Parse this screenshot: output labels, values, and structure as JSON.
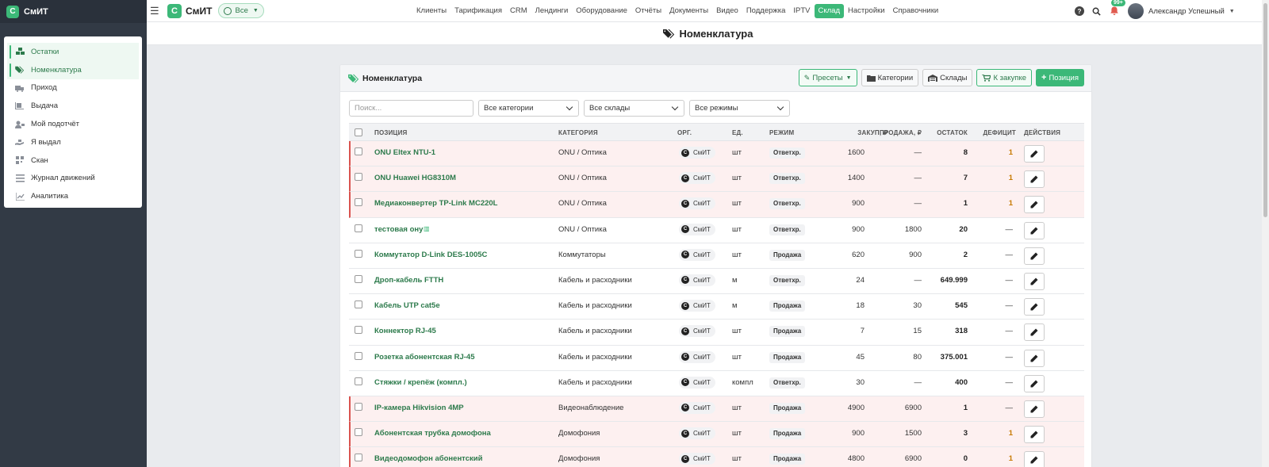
{
  "sidebar": {
    "logo_letter": "С",
    "logo_text": "СмИТ",
    "items": [
      {
        "label": "Остатки",
        "icon": "boxes-icon",
        "active": true
      },
      {
        "label": "Номенклатура",
        "icon": "tags-icon",
        "active": true
      },
      {
        "label": "Приход",
        "icon": "truck-loading-icon",
        "active": false
      },
      {
        "label": "Выдача",
        "icon": "dolly-icon",
        "active": false
      },
      {
        "label": "Мой подотчёт",
        "icon": "user-tag-icon",
        "active": false
      },
      {
        "label": "Я выдал",
        "icon": "hand-holding-icon",
        "active": false
      },
      {
        "label": "Скан",
        "icon": "qrcode-icon",
        "active": false
      },
      {
        "label": "Журнал движений",
        "icon": "list-icon",
        "active": false
      },
      {
        "label": "Аналитика",
        "icon": "chart-line-icon",
        "active": false
      }
    ]
  },
  "topbar": {
    "logo_letter": "С",
    "logo_text": "СмИТ",
    "scope_label": "Все",
    "nav": [
      "Клиенты",
      "Тарификация",
      "CRM",
      "Лендинги",
      "Оборудование",
      "Отчёты",
      "Документы",
      "Видео",
      "Поддержка",
      "IPTV",
      "Склад",
      "Настройки",
      "Справочники"
    ],
    "active_nav": "Склад",
    "help": "?",
    "notif_badge": "99+",
    "user_name": "Александр Успешный"
  },
  "page_header": {
    "title": "Номенклатура"
  },
  "card": {
    "title": "Номенклатура",
    "buttons": {
      "presets": "Пресеты",
      "categories": "Категории",
      "warehouses": "Склады",
      "to_purchase": "К закупке",
      "add_position": "Позиция"
    },
    "filters": {
      "search_placeholder": "Поиск...",
      "category": "Все категории",
      "warehouse": "Все склады",
      "mode": "Все режимы"
    },
    "columns": [
      "Позиция",
      "Категория",
      "Орг.",
      "Ед.",
      "Режим",
      "Закуп, ₽",
      "Продажа, ₽",
      "Остаток",
      "Дефицит",
      "Действия"
    ],
    "rows": [
      {
        "name": "ONU Eltex NTU-1",
        "category": "ONU / Оптика",
        "org": "СмИТ",
        "unit": "шт",
        "mode": "Ответхр.",
        "buy": "1600",
        "sell": "—",
        "stock": "8",
        "deficit": "1",
        "highlight": true
      },
      {
        "name": "ONU Huawei HG8310M",
        "category": "ONU / Оптика",
        "org": "СмИТ",
        "unit": "шт",
        "mode": "Ответхр.",
        "buy": "1400",
        "sell": "—",
        "stock": "7",
        "deficit": "1",
        "highlight": true
      },
      {
        "name": "Медиаконвертер TP-Link MC220L",
        "category": "ONU / Оптика",
        "org": "СмИТ",
        "unit": "шт",
        "mode": "Ответхр.",
        "buy": "900",
        "sell": "—",
        "stock": "1",
        "deficit": "1",
        "highlight": true
      },
      {
        "name": "тестовая ону",
        "category": "ONU / Оптика",
        "org": "СмИТ",
        "unit": "шт",
        "mode": "Ответхр.",
        "buy": "900",
        "sell": "1800",
        "stock": "20",
        "deficit": "—",
        "highlight": false
      },
      {
        "name": "Коммутатор D-Link DES-1005C",
        "category": "Коммутаторы",
        "org": "СмИТ",
        "unit": "шт",
        "mode": "Продажа",
        "buy": "620",
        "sell": "900",
        "stock": "2",
        "deficit": "—",
        "highlight": false
      },
      {
        "name": "Дроп-кабель FTTH",
        "category": "Кабель и расходники",
        "org": "СмИТ",
        "unit": "м",
        "mode": "Ответхр.",
        "buy": "24",
        "sell": "—",
        "stock": "649.999",
        "deficit": "—",
        "highlight": false
      },
      {
        "name": "Кабель UTP cat5e",
        "category": "Кабель и расходники",
        "org": "СмИТ",
        "unit": "м",
        "mode": "Продажа",
        "buy": "18",
        "sell": "30",
        "stock": "545",
        "deficit": "—",
        "highlight": false
      },
      {
        "name": "Коннектор RJ-45",
        "category": "Кабель и расходники",
        "org": "СмИТ",
        "unit": "шт",
        "mode": "Продажа",
        "buy": "7",
        "sell": "15",
        "stock": "318",
        "deficit": "—",
        "highlight": false
      },
      {
        "name": "Розетка абонентская RJ-45",
        "category": "Кабель и расходники",
        "org": "СмИТ",
        "unit": "шт",
        "mode": "Продажа",
        "buy": "45",
        "sell": "80",
        "stock": "375.001",
        "deficit": "—",
        "highlight": false
      },
      {
        "name": "Стяжки / крепёж (компл.)",
        "category": "Кабель и расходники",
        "org": "СмИТ",
        "unit": "компл",
        "mode": "Ответхр.",
        "buy": "30",
        "sell": "—",
        "stock": "400",
        "deficit": "—",
        "highlight": false
      },
      {
        "name": "IP-камера Hikvision 4MP",
        "category": "Видеонаблюдение",
        "org": "СмИТ",
        "unit": "шт",
        "mode": "Продажа",
        "buy": "4900",
        "sell": "6900",
        "stock": "1",
        "deficit": "—",
        "highlight": true
      },
      {
        "name": "Абонентская трубка домофона",
        "category": "Домофония",
        "org": "СмИТ",
        "unit": "шт",
        "mode": "Продажа",
        "buy": "900",
        "sell": "1500",
        "stock": "3",
        "deficit": "1",
        "highlight": true
      },
      {
        "name": "Видеодомофон абонентский",
        "category": "Домофония",
        "org": "СмИТ",
        "unit": "шт",
        "mode": "Продажа",
        "buy": "4800",
        "sell": "6900",
        "stock": "0",
        "deficit": "1",
        "highlight": true
      }
    ]
  }
}
